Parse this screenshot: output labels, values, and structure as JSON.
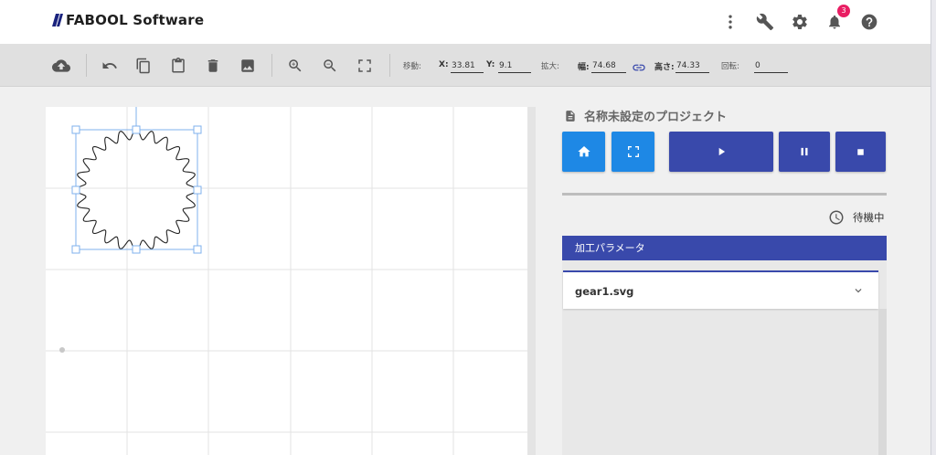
{
  "app": {
    "logo_text": "FABOOL Software",
    "notification_count": "3"
  },
  "header": {
    "icons": [
      "more-vert-icon",
      "wrench-icon",
      "gear-icon",
      "bell-icon",
      "help-icon"
    ]
  },
  "toolbar": {
    "move_label": "移動:",
    "x_label": "X:",
    "x_value": "33.81",
    "y_label": "Y:",
    "y_value": "9.1",
    "scale_label": "拡大:",
    "width_label": "幅:",
    "width_value": "74.68",
    "height_label": "高さ:",
    "height_value": "74.33",
    "rotate_label": "回転:",
    "rotate_value": "0"
  },
  "canvas": {
    "shape": "gear",
    "gear_teeth": 24
  },
  "panel": {
    "project_title": "名称未設定のプロジェクト",
    "status_text": "待機中",
    "params_header": "加工パラメータ",
    "file_name": "gear1.svg",
    "progress": 0
  },
  "colors": {
    "primary_light": "#1e88e5",
    "primary_dark": "#3949ab",
    "badge": "#e91e63",
    "selection": "#7fb0ec"
  }
}
